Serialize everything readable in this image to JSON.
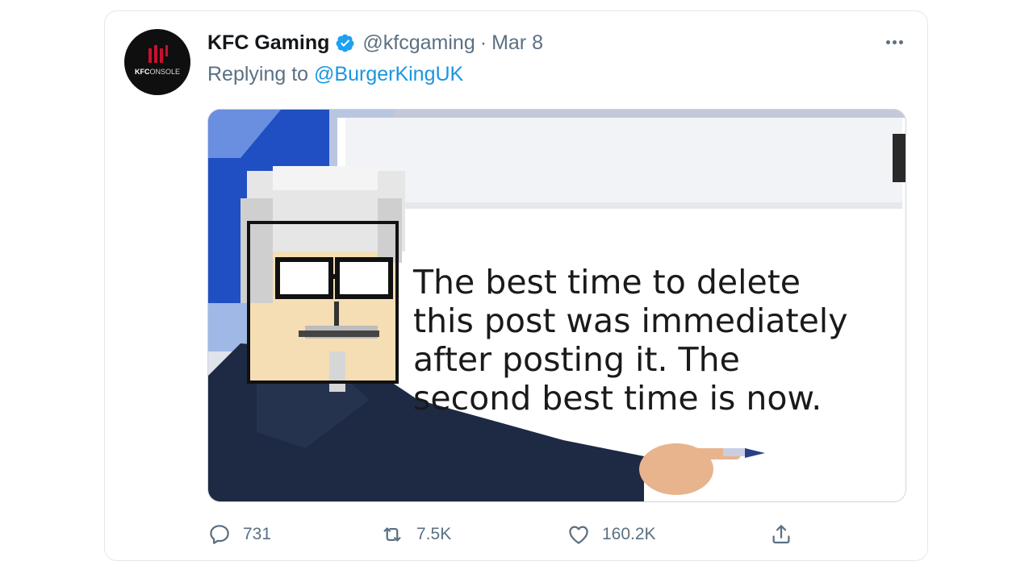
{
  "tweet": {
    "author_name": "KFC Gaming",
    "handle": "@kfcgaming",
    "separator": "·",
    "date": "Mar 8",
    "replying_prefix": "Replying to",
    "replying_to": "@BurgerKingUK",
    "avatar_logo": "KFCONSOLE",
    "avatar_logo_bold": "KFC",
    "avatar_logo_rest": "ONSOLE",
    "verified_icon": "verified-badge-icon",
    "more_icon": "more-options-icon",
    "accent_color": "#1b95e0",
    "secondary_text_color": "#5b7083"
  },
  "media": {
    "meme_lines": [
      "The best time to delete",
      "this post was immediately",
      "after posting it. The",
      "second best time is now."
    ]
  },
  "actions": {
    "reply": {
      "icon": "reply-icon",
      "count": "731"
    },
    "retweet": {
      "icon": "retweet-icon",
      "count": "7.5K"
    },
    "like": {
      "icon": "heart-icon",
      "count": "160.2K"
    },
    "share": {
      "icon": "share-icon"
    }
  }
}
